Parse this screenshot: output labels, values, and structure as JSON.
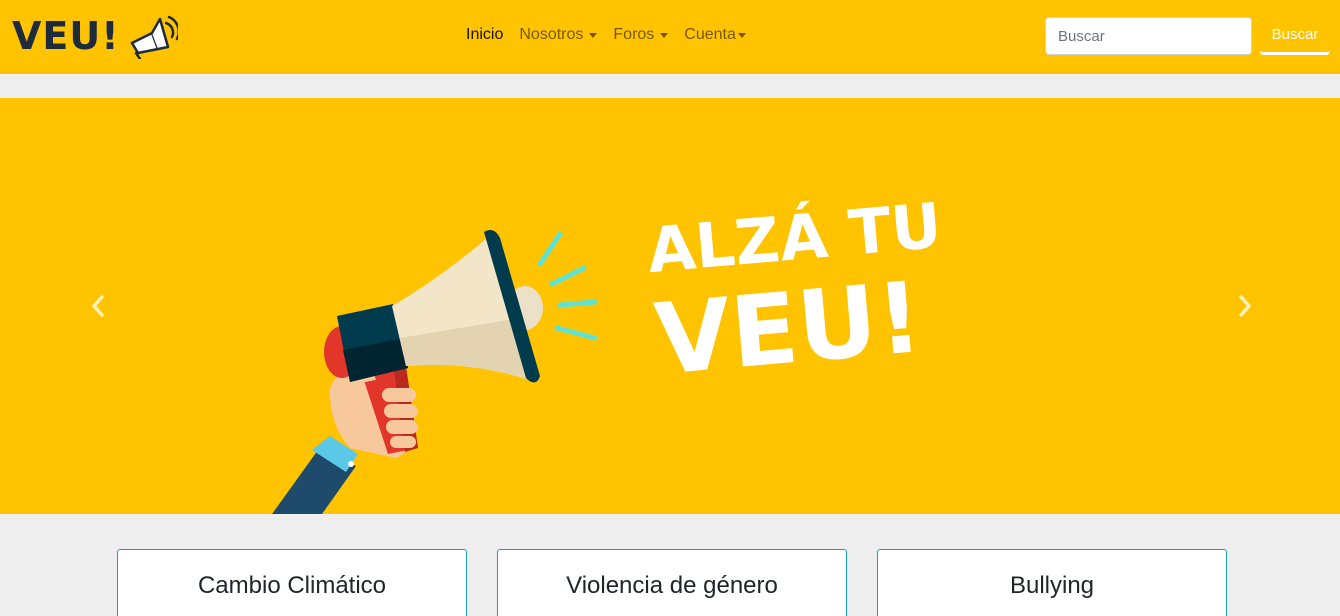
{
  "brand": {
    "logo_text": "VEU!",
    "logo_icon": "megaphone-icon"
  },
  "nav": {
    "items": [
      {
        "label": "Inicio",
        "active": true,
        "dropdown": false
      },
      {
        "label": "Nosotros",
        "active": false,
        "dropdown": true
      },
      {
        "label": "Foros",
        "active": false,
        "dropdown": true
      },
      {
        "label": "Cuenta",
        "active": false,
        "dropdown": true
      }
    ]
  },
  "search": {
    "placeholder": "Buscar",
    "value": "",
    "button_label": "Buscar"
  },
  "carousel": {
    "slide_text_line1": "ALZÁ TU",
    "slide_text_line2": "VEU!",
    "prev_icon": "chevron-left-icon",
    "next_icon": "chevron-right-icon"
  },
  "cards": [
    {
      "title": "Cambio Climático"
    },
    {
      "title": "Violencia de género"
    },
    {
      "title": "Bullying"
    }
  ],
  "colors": {
    "brand_yellow": "#ffc300",
    "dark_navy": "#1e2b3a",
    "card_border": "#17a2b8",
    "background": "#eeeeee"
  }
}
